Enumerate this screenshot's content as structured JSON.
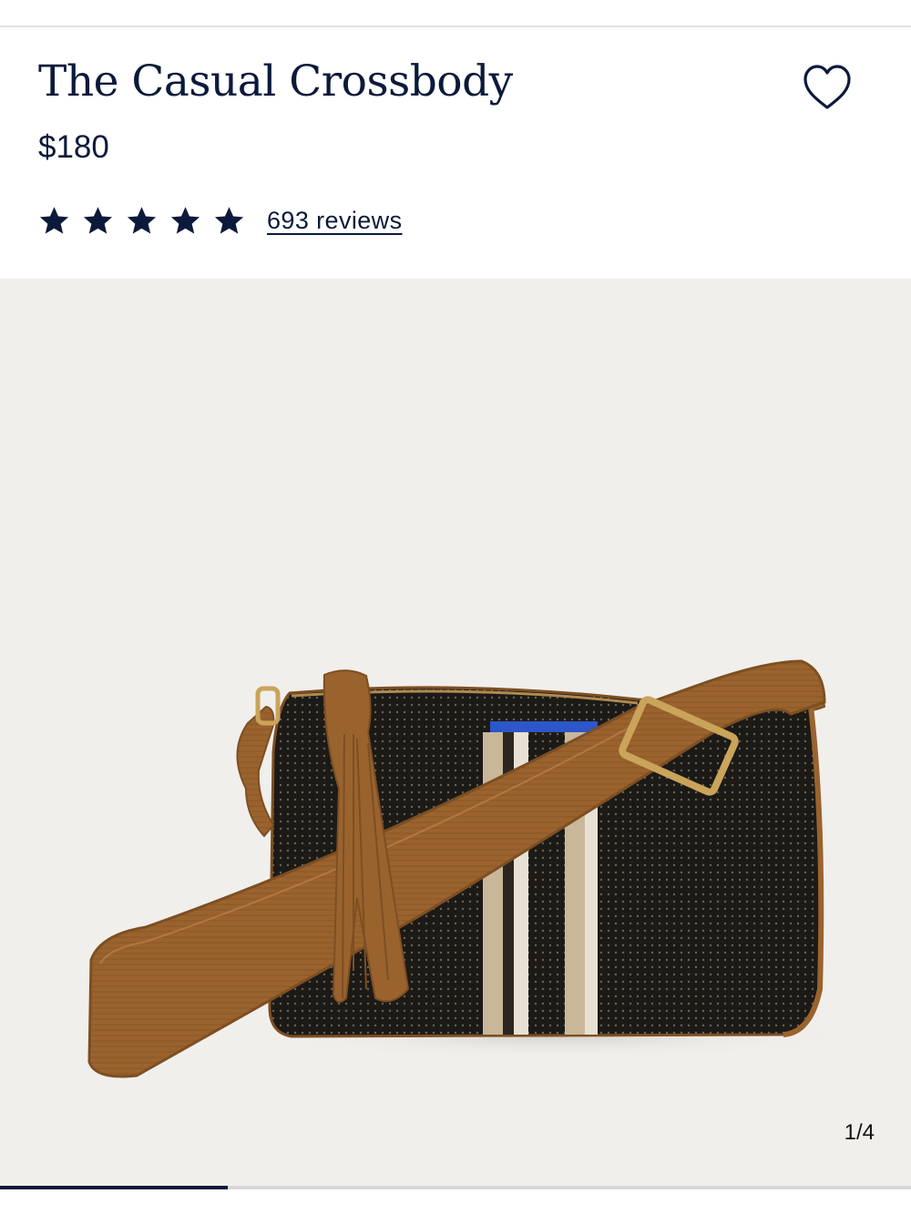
{
  "product": {
    "title": "The Casual Crossbody",
    "price": "$180",
    "rating": 5,
    "reviews_label": "693 reviews"
  },
  "wishlist": {
    "icon": "heart-outline-icon",
    "saved": false
  },
  "gallery": {
    "counter": "1/4",
    "current_index": 1,
    "total": 4,
    "progress": 0.25
  },
  "colors": {
    "navy": "#0b1a3b",
    "background": "#f1efec",
    "strap": "#9a632e",
    "bag_body": "#1c1a17",
    "accent_blue": "#2c56c9",
    "hardware_gold": "#c9a45a"
  }
}
